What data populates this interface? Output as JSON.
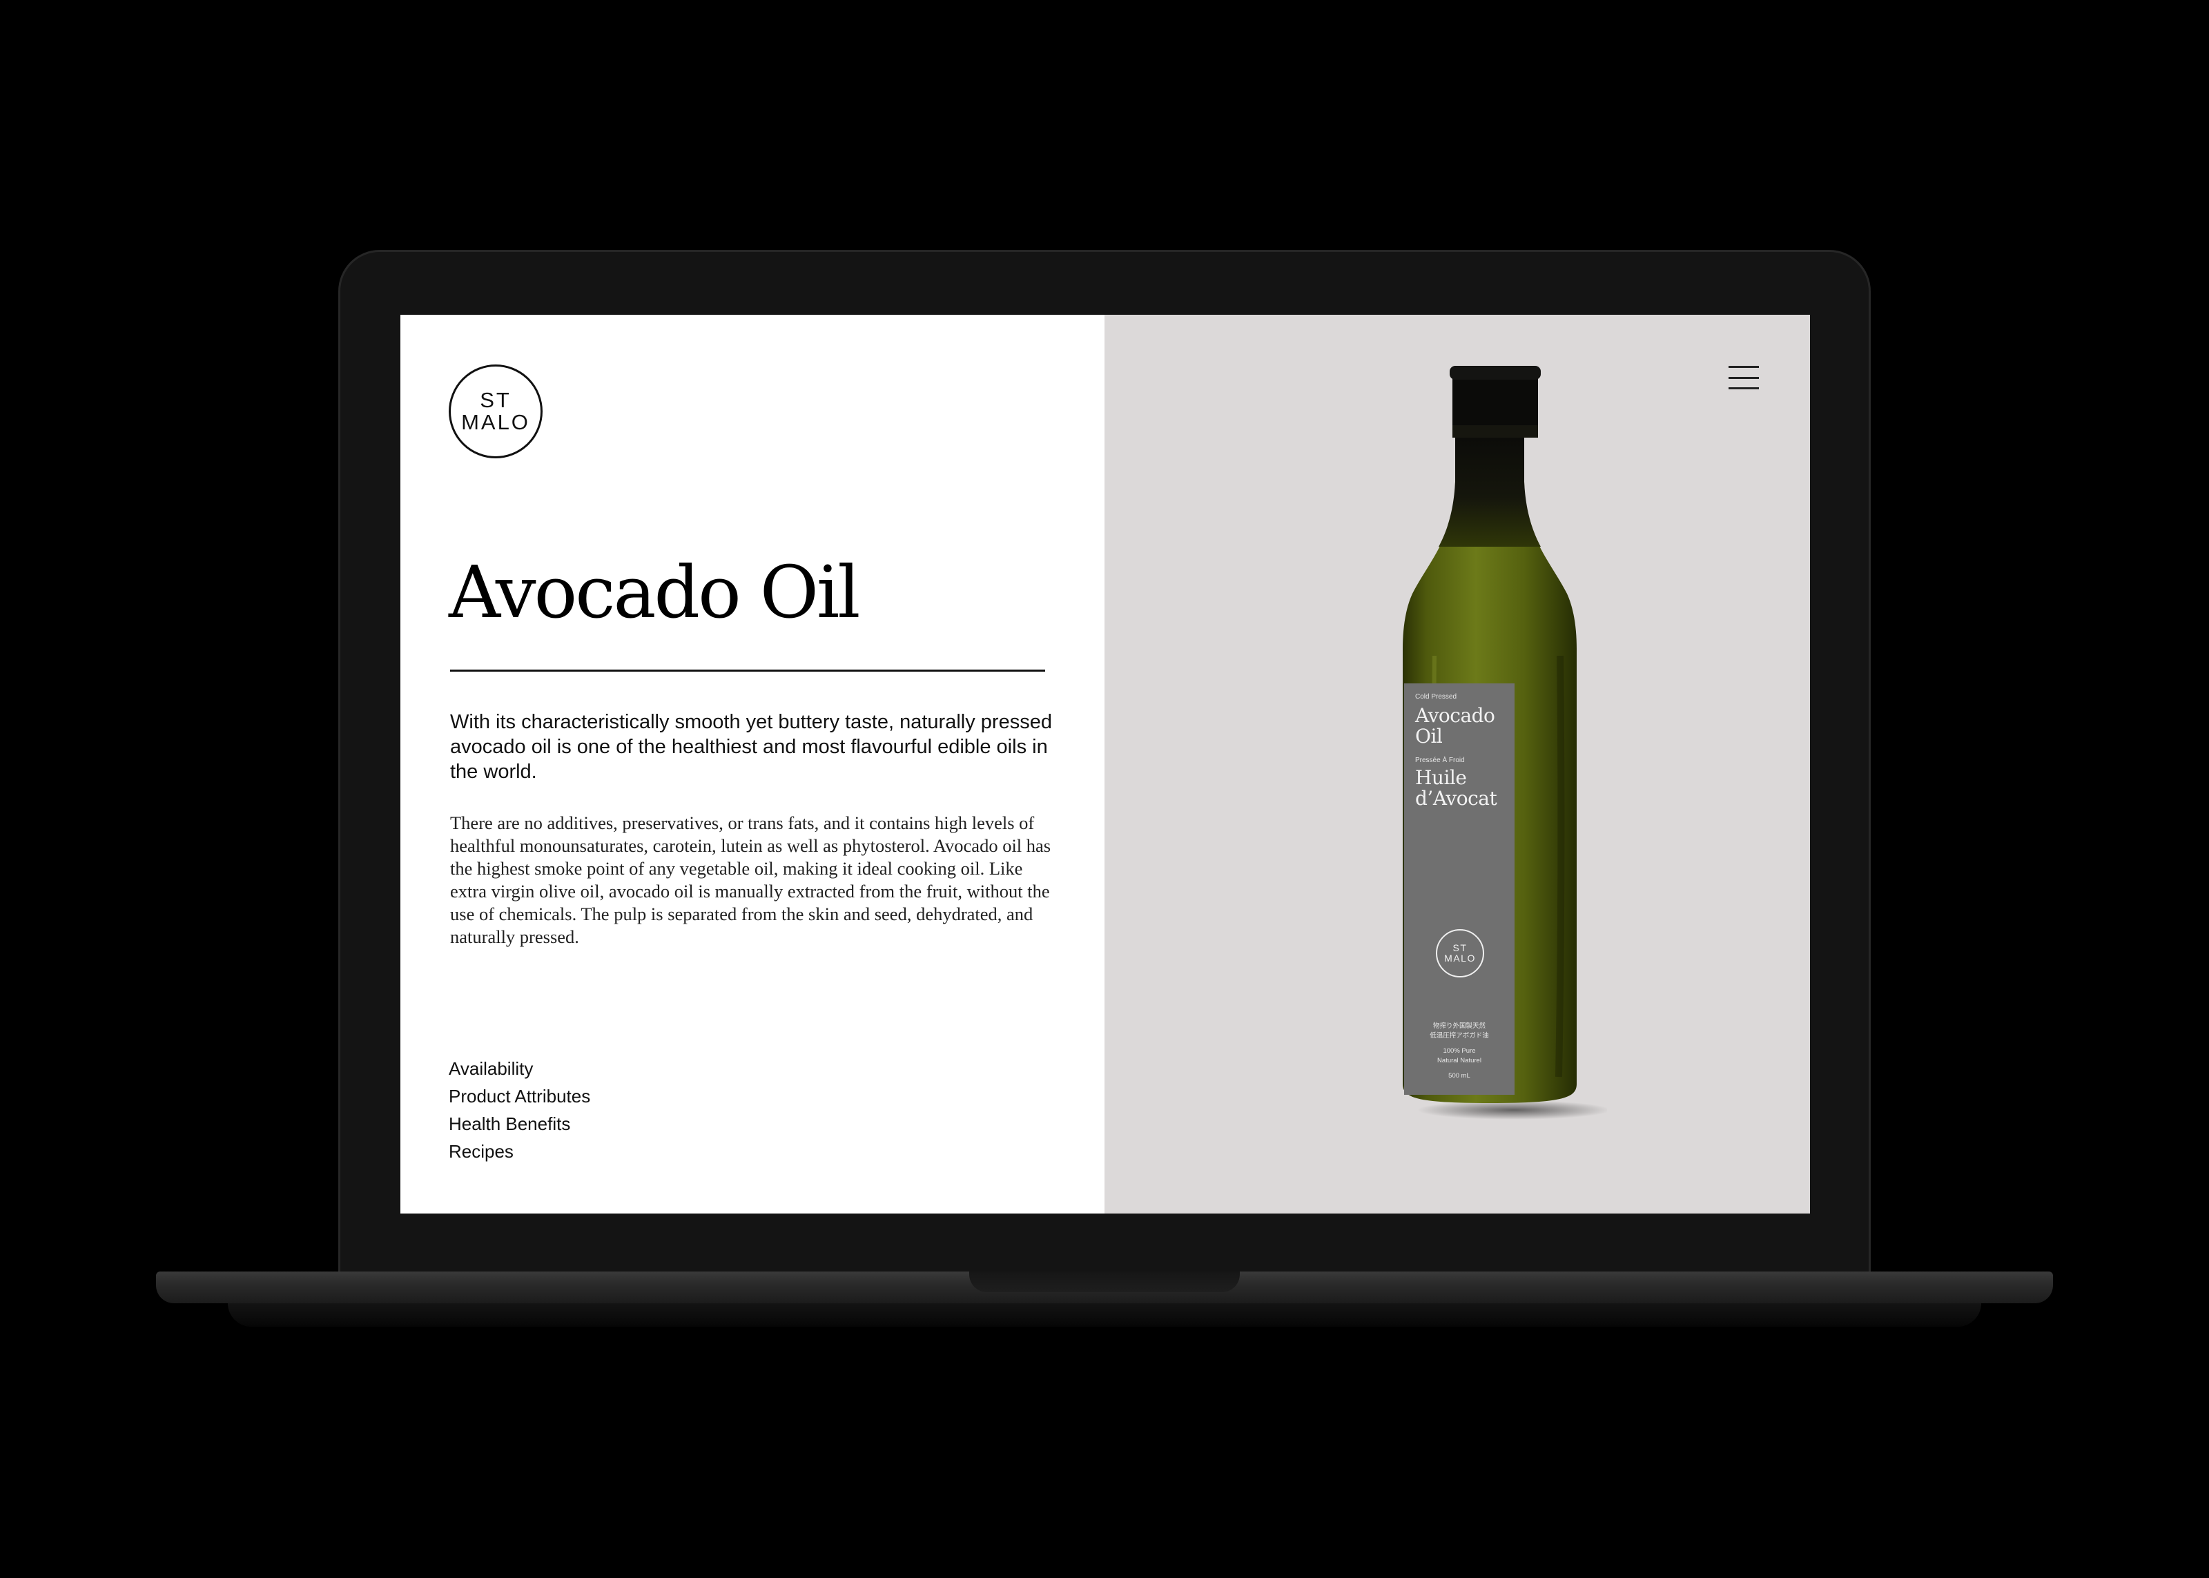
{
  "brand": {
    "logo_line1": "ST",
    "logo_line2": "MALO"
  },
  "product": {
    "title": "Avocado Oil",
    "lead": "With its characteristically smooth yet buttery taste, naturally pressed avocado oil is one of the healthiest and most flavourful edible oils in the world.",
    "body": "There are no additives, preservatives, or trans fats, and it contains high levels of healthful monounsaturates, carotein, lutein as well as phytosterol. Avocado oil has the highest smoke point of any vegetable oil, making it ideal cooking oil. Like extra virgin olive oil, avocado oil is manually extracted from the fruit, without the use of chemicals. The pulp is separated from the skin and seed, dehydrated, and naturally pressed."
  },
  "nav": {
    "items": [
      "Availability",
      "Product Attributes",
      "Health Benefits",
      "Recipes"
    ]
  },
  "menu": {
    "icon": "hamburger-menu-icon"
  },
  "bottle_label": {
    "cold_pressed": "Cold Pressed",
    "name_en": "Avocado Oil",
    "presse": "Pressée À Froid",
    "name_fr": "Huile d’Avocat",
    "logo_line1": "ST",
    "logo_line2": "MALO",
    "jp_line1": "物搾り外国製天然",
    "jp_line2": "低温圧搾アボガド油",
    "purity_line1": "100% Pure",
    "purity_line2": "Natural Naturel",
    "volume": "500 mL"
  },
  "colors": {
    "page_background": "#000000",
    "left_panel": "#ffffff",
    "right_panel": "#dcd9d9",
    "bottle_oil": "#5d6a12",
    "bottle_cap": "#0d0d0a",
    "label": "#707070"
  }
}
